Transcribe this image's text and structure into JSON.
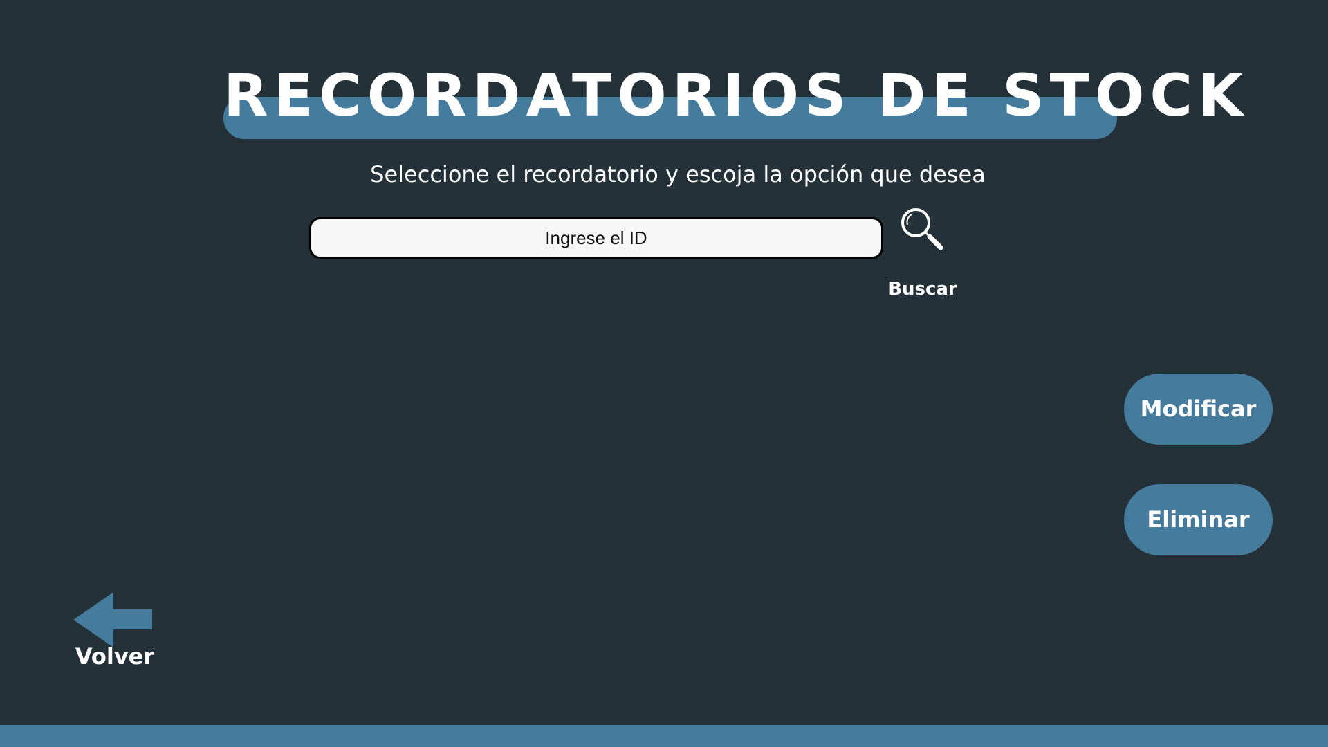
{
  "header": {
    "title": "RECORDATORIOS DE STOCK",
    "subtitle": "Seleccione el recordatorio y escoja la opción que desea"
  },
  "search": {
    "placeholder": "Ingrese el ID",
    "value": "",
    "button_label": "Buscar",
    "icon": "search-icon"
  },
  "actions": {
    "modify_label": "Modificar",
    "delete_label": "Eliminar"
  },
  "navigation": {
    "back_label": "Volver",
    "back_icon": "arrow-left-icon"
  },
  "colors": {
    "background": "#243139",
    "accent": "#457b9d",
    "text": "#ffffff",
    "input_background": "#f7f7f7"
  }
}
